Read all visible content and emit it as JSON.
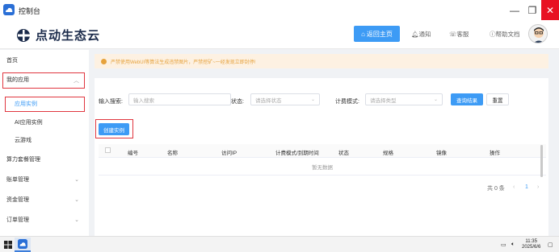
{
  "window": {
    "title": "控制台",
    "minimize_glyph": "—",
    "maximize_glyph": "❐",
    "close_glyph": "✕"
  },
  "header": {
    "logo_text": "点动生态云",
    "home_button": "返回主页",
    "notify": "通知",
    "service": "客服",
    "help": "帮助文档"
  },
  "sidebar": {
    "items": [
      {
        "label": "首页"
      },
      {
        "label": "我的应用",
        "expandable": true
      },
      {
        "label": "应用实例",
        "active": true
      },
      {
        "label": "AI应用实例"
      },
      {
        "label": "云游戏"
      },
      {
        "label": "算力套餐管理"
      },
      {
        "label": "账单管理",
        "expandable": true
      },
      {
        "label": "资金管理",
        "expandable": true
      },
      {
        "label": "订单管理",
        "expandable": true
      }
    ],
    "chevron": "⌄"
  },
  "notice": {
    "text": "严禁使用WebUI等算法生成违禁图片，严禁挖矿~一经发现立即封停!"
  },
  "filters": {
    "search_label": "输入搜索:",
    "search_placeholder": "输入搜索",
    "status_label": "状态:",
    "status_placeholder": "请选择状态",
    "billing_label": "计费模式:",
    "billing_placeholder": "请选择类型",
    "query_button": "查询结果",
    "reset_button": "重置"
  },
  "create_button": "创建实例",
  "table": {
    "columns": [
      "编号",
      "名称",
      "访问IP",
      "计费模式/到期时间",
      "状态",
      "规格",
      "镜像",
      "操作"
    ],
    "empty_text": "暂无数据"
  },
  "pager": {
    "total": "共 0 条",
    "prev": "‹",
    "page": "1",
    "next": "›"
  },
  "taskbar": {
    "time": "11:35",
    "date": "2025/6/6"
  },
  "colors": {
    "accent": "#3d9bf5",
    "highlight": "#e0363f",
    "notice_bg": "#fdf1e2",
    "notice_text": "#e6a23c"
  }
}
